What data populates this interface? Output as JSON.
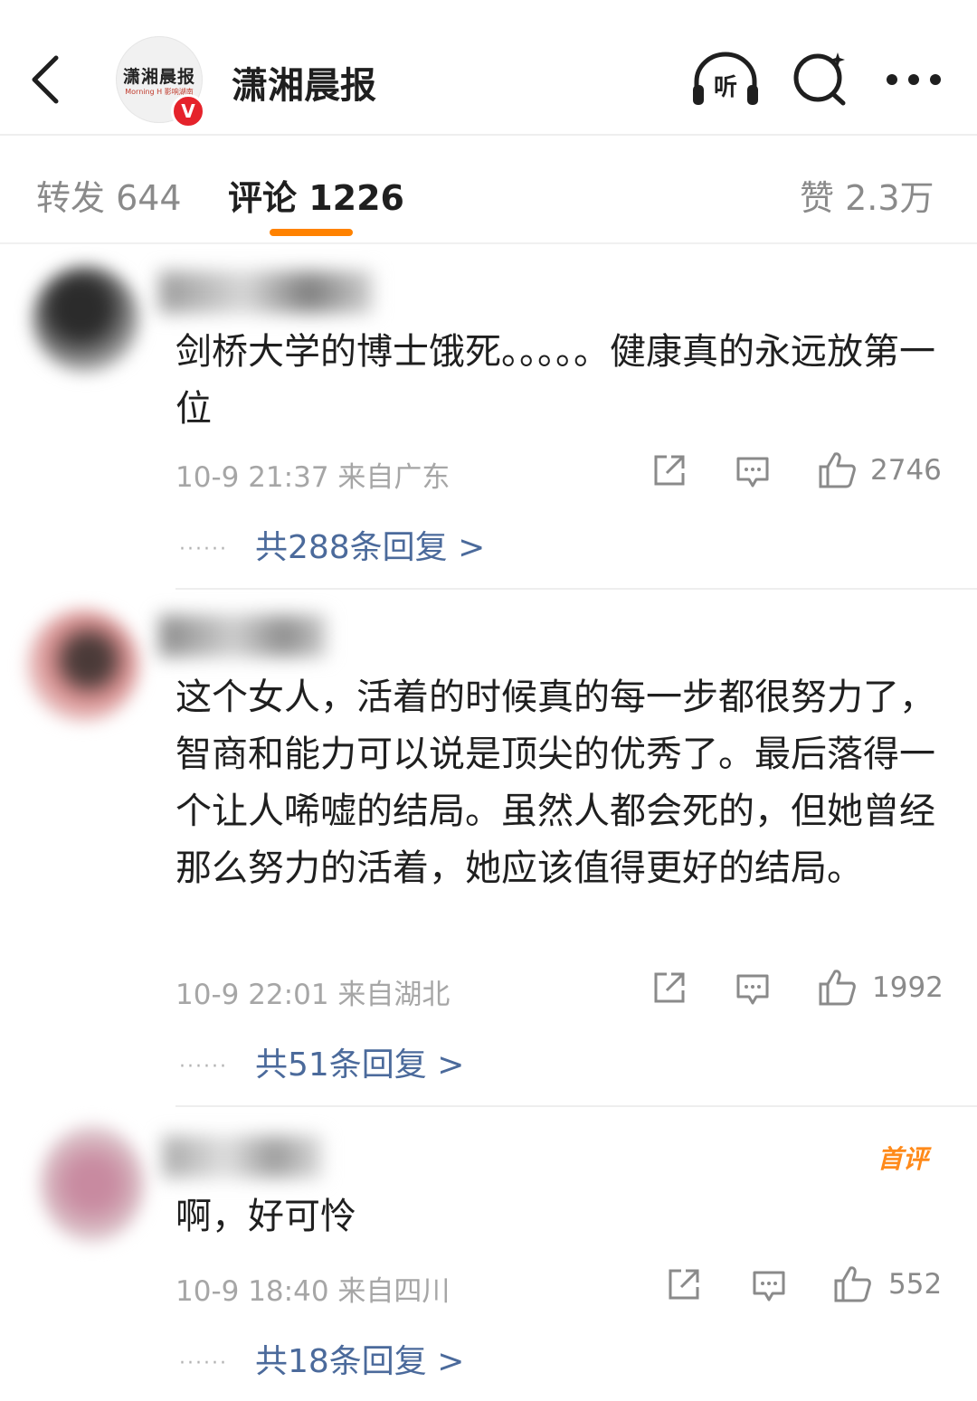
{
  "header": {
    "account_name": "潇湘晨报",
    "logo_text": "潇湘晨报",
    "logo_sub": "Morning H 影响湖南",
    "verified_mark": "V",
    "listen_label": "听"
  },
  "tabs": {
    "repost": "转发 644",
    "comments": "评论 1226",
    "likes": "赞 2.3万"
  },
  "comments": [
    {
      "text": "剑桥大学的博士饿死。。。。。健康真的永远放第一位",
      "meta": "10-9 21:37 来自广东",
      "likes": "2746",
      "replies": "共288条回复 >"
    },
    {
      "text": "这个女人，活着的时候真的每一步都很努力了，智商和能力可以说是顶尖的优秀了。最后落得一个让人唏嘘的结局。虽然人都会死的，但她曾经那么努力的活着，她应该值得更好的结局。",
      "meta": "10-9 22:01 来自湖北",
      "likes": "1992",
      "replies": "共51条回复 >"
    },
    {
      "text": "啊，好可怜",
      "meta": "10-9 18:40 来自四川",
      "likes": "552",
      "replies": "共18条回复 >",
      "badge": "首评"
    }
  ],
  "ui": {
    "dots": "······"
  },
  "colors": {
    "accent": "#ff8200",
    "link": "#4b6a9b",
    "verified": "#e5232b"
  },
  "icons": [
    "back-arrow-icon",
    "listen-headphones-icon",
    "search-icon",
    "more-icon",
    "share-icon",
    "comment-icon",
    "like-icon"
  ]
}
